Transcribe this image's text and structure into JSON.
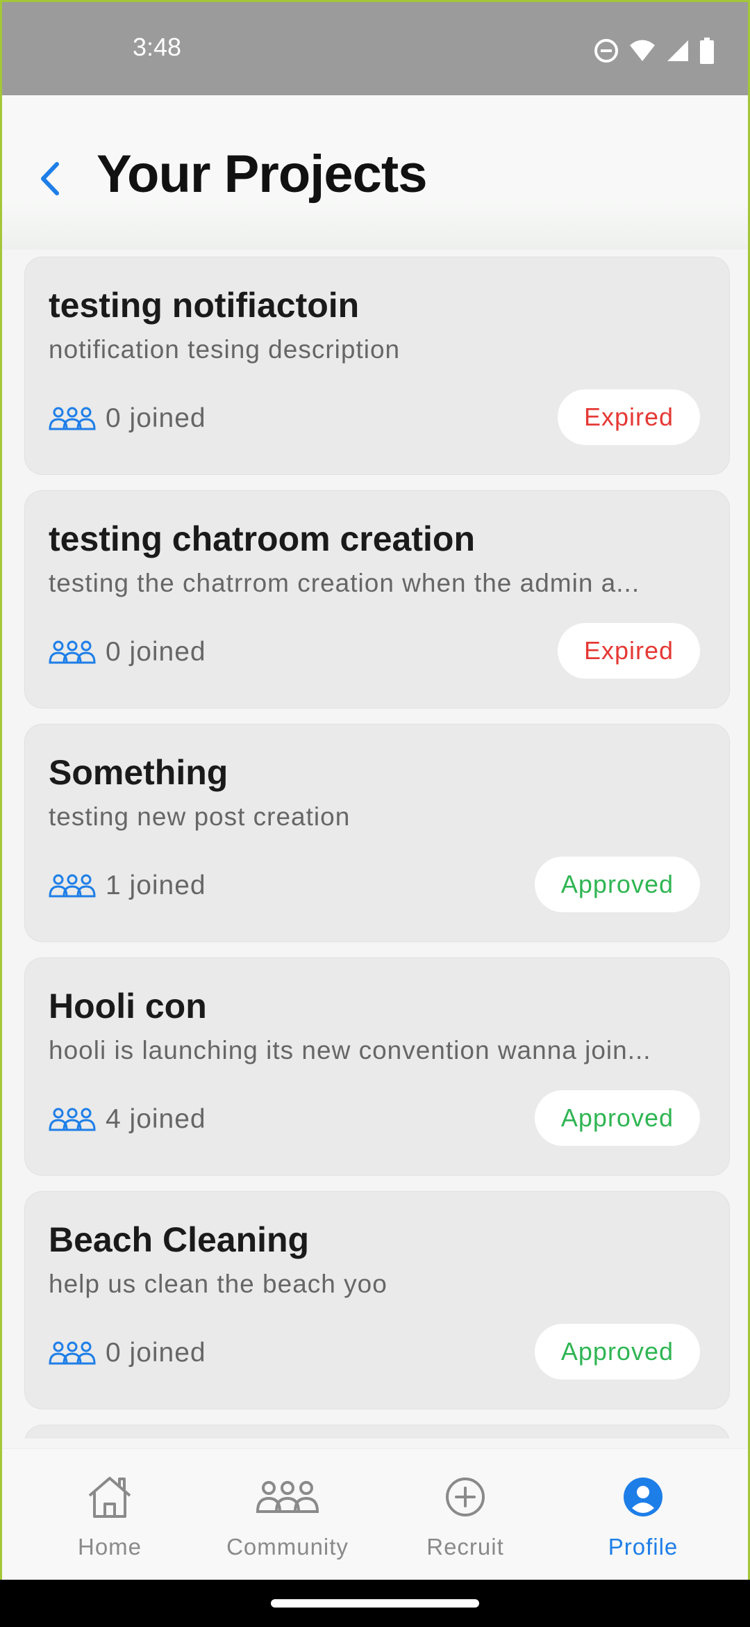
{
  "status_bar": {
    "time": "3:48"
  },
  "header": {
    "title": "Your Projects"
  },
  "projects": [
    {
      "title": "testing notifiactoin",
      "description": "notification tesing description",
      "joined": "0 joined",
      "status": "Expired"
    },
    {
      "title": "testing chatroom creation",
      "description": "testing the chatrrom creation when the admin a...",
      "joined": "0 joined",
      "status": "Expired"
    },
    {
      "title": "Something",
      "description": "testing new post creation",
      "joined": "1 joined",
      "status": "Approved"
    },
    {
      "title": "Hooli con",
      "description": "hooli is launching its new convention wanna join...",
      "joined": "4 joined",
      "status": "Approved"
    },
    {
      "title": "Beach Cleaning",
      "description": "help us clean the beach yoo",
      "joined": "0 joined",
      "status": "Approved"
    }
  ],
  "bottom_nav": {
    "items": [
      {
        "label": "Home",
        "icon": "home-icon"
      },
      {
        "label": "Community",
        "icon": "people-icon"
      },
      {
        "label": "Recruit",
        "icon": "add-circle-icon"
      },
      {
        "label": "Profile",
        "icon": "user-circle-icon",
        "active": true
      }
    ]
  },
  "colors": {
    "accent": "#1e7ee8",
    "expired": "#e53935",
    "approved": "#2fb553",
    "card_background": "#e9eae9"
  }
}
